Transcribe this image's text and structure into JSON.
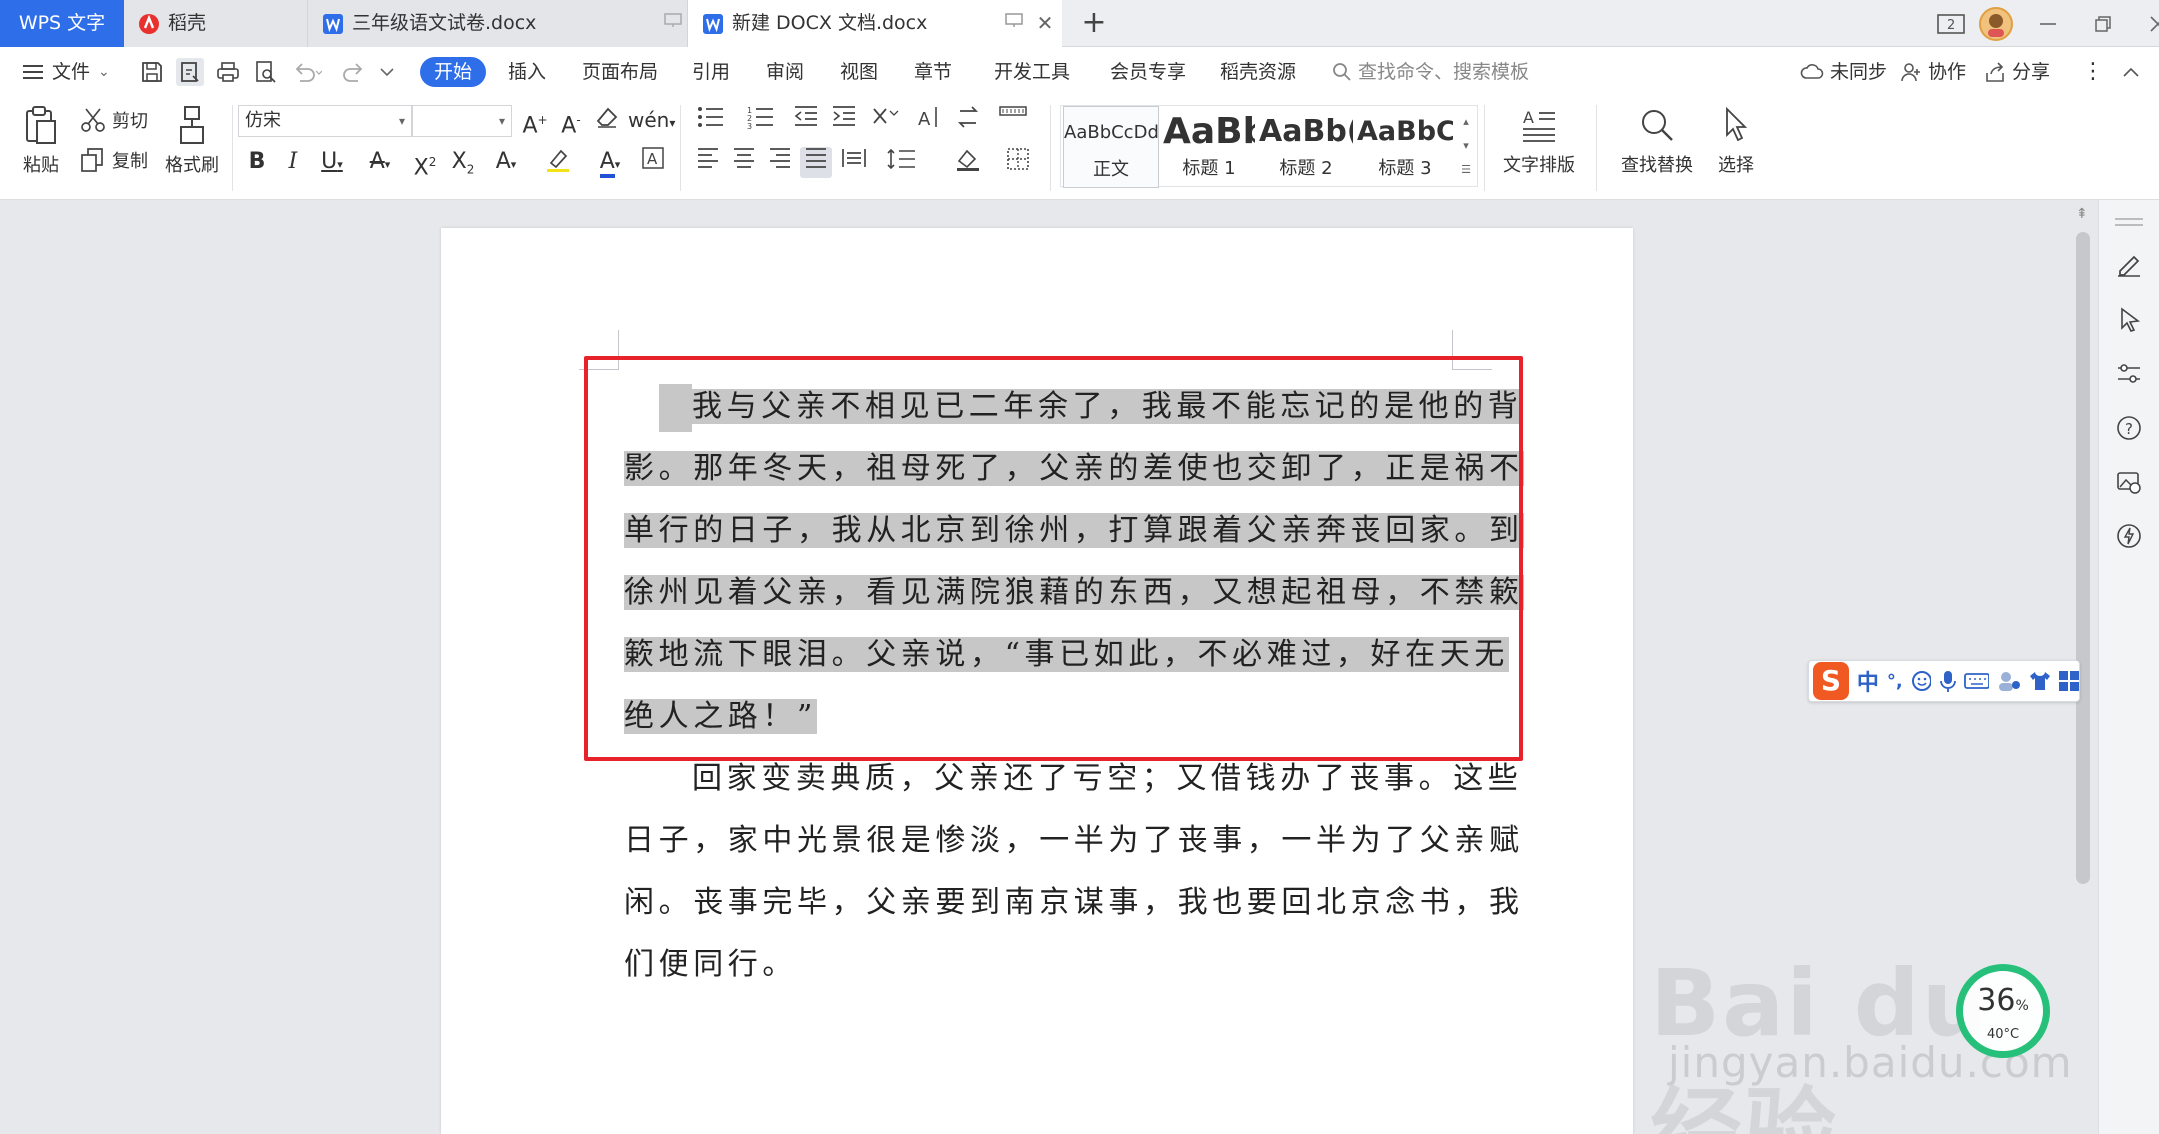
{
  "tabs": {
    "app_name": "WPS 文字",
    "items": [
      {
        "label": "稻壳"
      },
      {
        "label": "三年级语文试卷.docx"
      },
      {
        "label": "新建 DOCX 文档.docx"
      }
    ],
    "new_tab": "+",
    "badge": "2"
  },
  "menu": {
    "file": "文件",
    "items": [
      "开始",
      "插入",
      "页面布局",
      "引用",
      "审阅",
      "视图",
      "章节",
      "开发工具",
      "会员专享",
      "稻壳资源"
    ],
    "search_placeholder": "查找命令、搜索模板",
    "unsynced": "未同步",
    "collab": "协作",
    "share": "分享"
  },
  "ribbon": {
    "paste": "粘贴",
    "cut": "剪切",
    "copy": "复制",
    "format_painter": "格式刷",
    "font_name": "仿宋",
    "font_size": "",
    "styles": [
      {
        "sample": "AaBbCcDd",
        "name": "正文"
      },
      {
        "sample": "AaBb",
        "name": "标题 1"
      },
      {
        "sample": "AaBb(",
        "name": "标题 2"
      },
      {
        "sample": "AaBbC(",
        "name": "标题 3"
      }
    ],
    "text_layout": "文字排版",
    "find_replace": "查找替换",
    "select": "选择"
  },
  "document": {
    "lines": [
      {
        "indent": true,
        "text": "我与父亲不相见已二年余了，我最不能忘记的是他的背",
        "highlight": true
      },
      {
        "indent": false,
        "text": "影。那年冬天，祖母死了，父亲的差使也交卸了，正是祸不",
        "highlight": true
      },
      {
        "indent": false,
        "text": "单行的日子，我从北京到徐州，打算跟着父亲奔丧回家。到",
        "highlight": true
      },
      {
        "indent": false,
        "text": "徐州见着父亲，看见满院狼藉的东西，又想起祖母，不禁簌",
        "highlight": true
      },
      {
        "indent": false,
        "text": "簌地流下眼泪。父亲说，“事已如此，不必难过，好在天无",
        "highlight": true
      },
      {
        "indent": false,
        "text": "绝人之路！”",
        "highlight": true
      },
      {
        "indent": true,
        "text": "回家变卖典质，父亲还了亏空；又借钱办了丧事。这些",
        "highlight": false
      },
      {
        "indent": false,
        "text": "日子，家中光景很是惨淡，一半为了丧事，一半为了父亲赋",
        "highlight": false
      },
      {
        "indent": false,
        "text": "闲。丧事完毕，父亲要到南京谋事，我也要回北京念书，我",
        "highlight": false
      },
      {
        "indent": false,
        "text": "们便同行。",
        "highlight": false
      }
    ]
  },
  "ime": {
    "mode": "中",
    "punct": "°,"
  },
  "watermark": {
    "main": "Bai du 经验",
    "sub": "jingyan.baidu.com"
  },
  "gauge": {
    "value": "36",
    "unit": "%",
    "temp": "40°C"
  },
  "colors": {
    "accent": "#2f6ee9",
    "selection_box": "#e8222a",
    "highlight": "#c7c7c7",
    "gauge": "#27c07a"
  }
}
